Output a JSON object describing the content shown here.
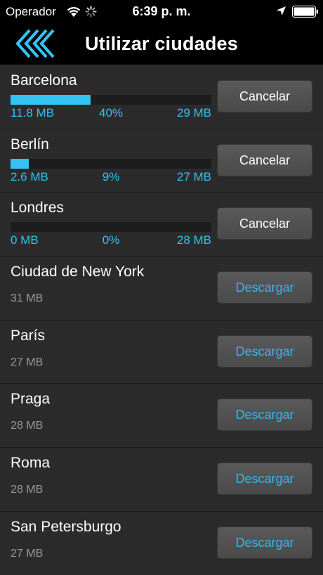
{
  "status_bar": {
    "carrier": "Operador",
    "time": "6:39 p. m."
  },
  "nav": {
    "title": "Utilizar ciudades"
  },
  "colors": {
    "accent": "#34c2f2",
    "background": "#2b2b2b",
    "button": "#515151"
  },
  "cities_downloading": [
    {
      "name": "Barcelona",
      "downloaded": "11.8 MB",
      "percent": "40%",
      "progress": 0.4,
      "total": "29 MB",
      "button": "Cancelar"
    },
    {
      "name": "Berlín",
      "downloaded": "2.6 MB",
      "percent": "9%",
      "progress": 0.09,
      "total": "27 MB",
      "button": "Cancelar"
    },
    {
      "name": "Londres",
      "downloaded": "0 MB",
      "percent": "0%",
      "progress": 0.0,
      "total": "28 MB",
      "button": "Cancelar"
    }
  ],
  "cities_available": [
    {
      "name": "Ciudad de New York",
      "size": "31 MB",
      "button": "Descargar"
    },
    {
      "name": "París",
      "size": "27 MB",
      "button": "Descargar"
    },
    {
      "name": "Praga",
      "size": "28 MB",
      "button": "Descargar"
    },
    {
      "name": "Roma",
      "size": "28 MB",
      "button": "Descargar"
    },
    {
      "name": "San Petersburgo",
      "size": "27 MB",
      "button": "Descargar"
    }
  ]
}
